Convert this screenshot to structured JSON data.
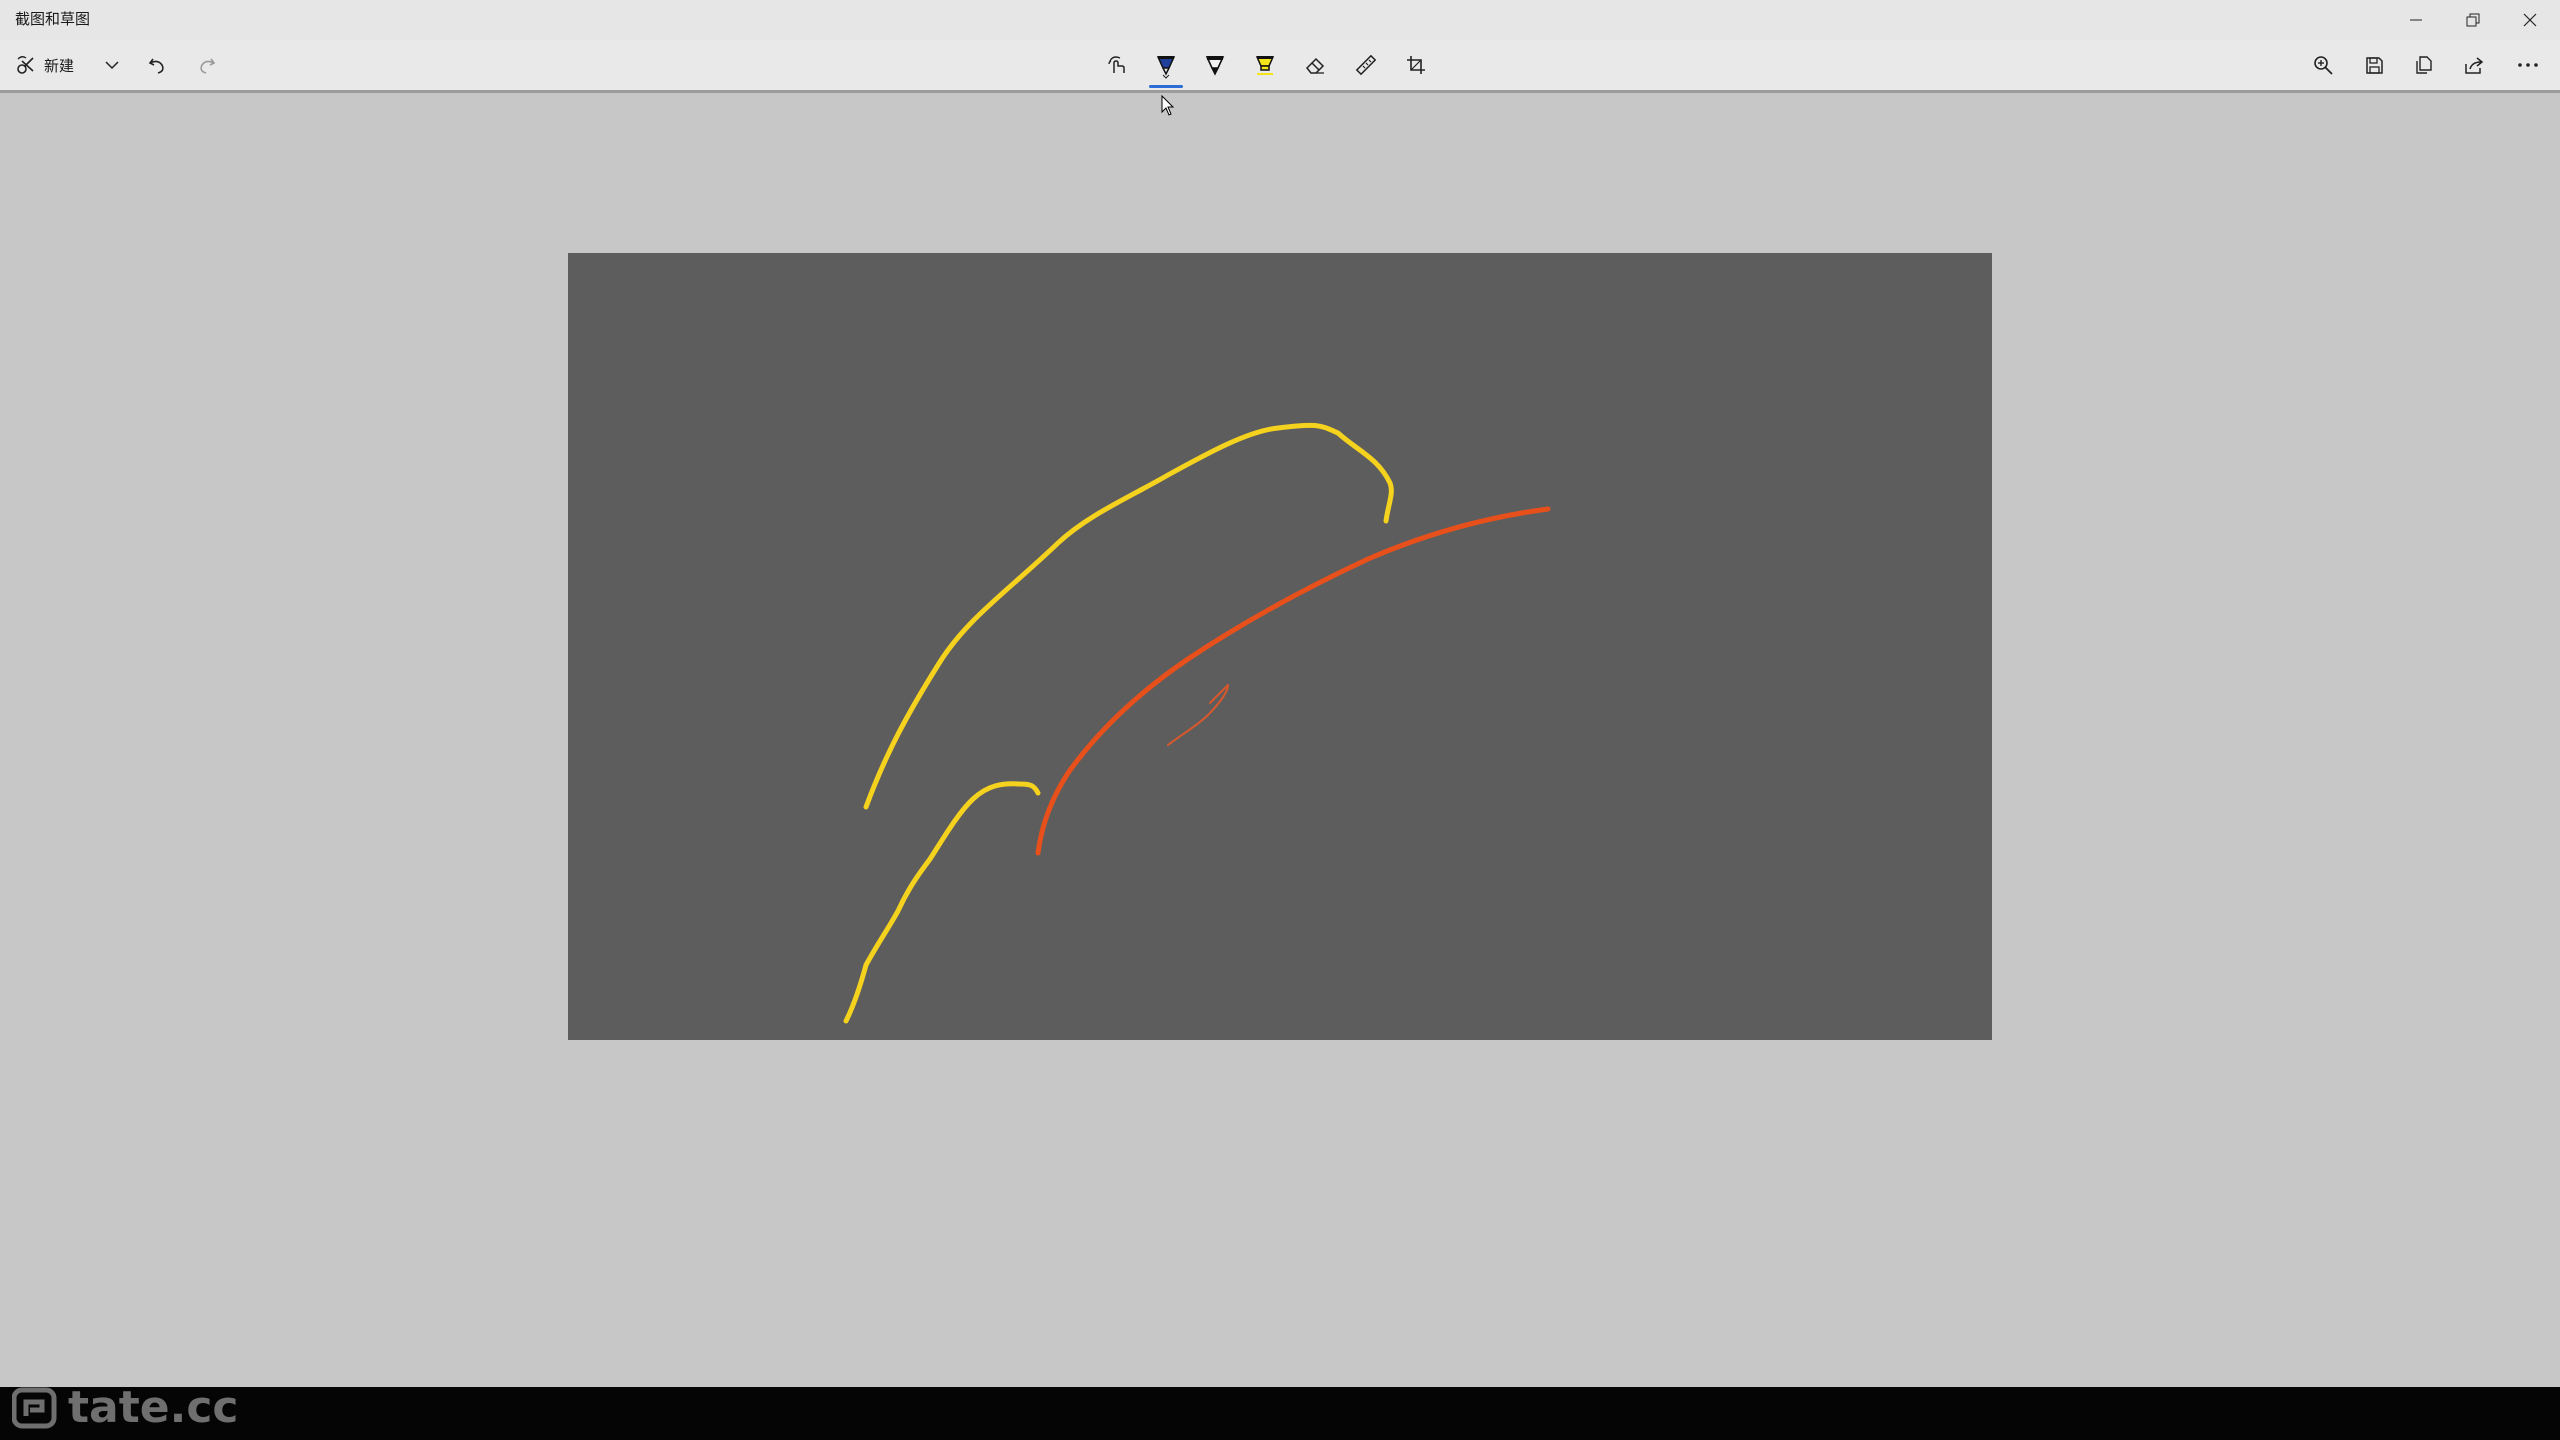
{
  "window": {
    "title": "截图和草图"
  },
  "toolbar": {
    "new_label": "新建",
    "left_icons": [
      "snip-new-icon",
      "chevron-down-icon",
      "undo-icon",
      "redo-icon"
    ],
    "center_icons": [
      "touch-writing-icon",
      "ballpoint-pen-icon",
      "pencil-icon",
      "highlighter-icon",
      "eraser-icon",
      "ruler-icon",
      "crop-icon"
    ],
    "right_icons": [
      "zoom-icon",
      "save-icon",
      "copy-icon",
      "share-icon",
      "more-icon"
    ],
    "active_tool": "ballpoint-pen",
    "ballpoint_color": "#1f3f9a",
    "pencil_color": "#111111",
    "highlighter_color": "#f2e51a"
  },
  "canvas": {
    "background": "#5d5d5d",
    "strokes": [
      {
        "name": "yellow-stroke-upper",
        "color": "#f4d21d"
      },
      {
        "name": "yellow-stroke-lower",
        "color": "#f4d21d"
      },
      {
        "name": "orange-stroke-long",
        "color": "#e8501b"
      },
      {
        "name": "orange-stroke-small",
        "color": "#d8582c"
      }
    ]
  },
  "watermark": {
    "text": "tate.cc"
  }
}
